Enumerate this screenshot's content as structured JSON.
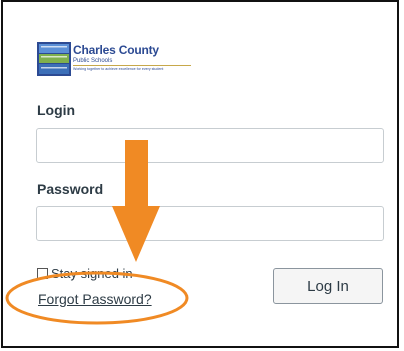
{
  "logo": {
    "mark_text": "",
    "name": "Charles County",
    "subtitle": "Public Schools",
    "tagline": "Working together to achieve excellence for every student"
  },
  "form": {
    "login_label": "Login",
    "login_value": "",
    "password_label": "Password",
    "password_value": "",
    "stay_signed_in_label": "Stay signed in",
    "forgot_password_link": "Forgot Password?",
    "login_button": "Log In"
  },
  "annotation": {
    "color": "#f08a24"
  },
  "colors": {
    "text": "#2d3b45",
    "brand_blue": "#2c4a93",
    "field_border": "#c7cdd1"
  }
}
